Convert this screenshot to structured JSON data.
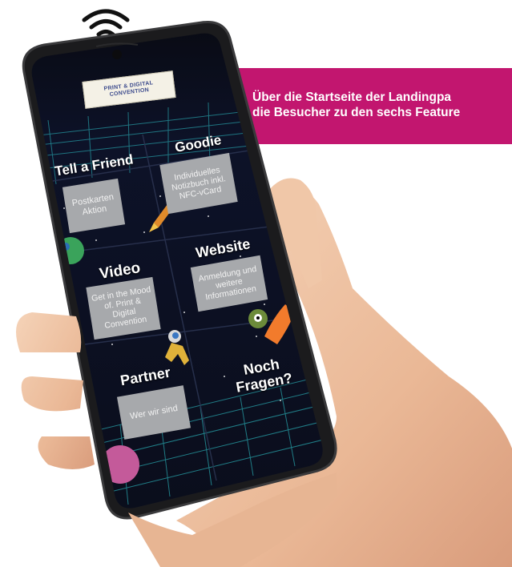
{
  "banner": {
    "line1": "Über die Startseite der Landingpa",
    "line2": "die Besucher zu den sechs Feature"
  },
  "app": {
    "logo_text": "PRINT & DIGITAL CONVENTION",
    "tiles": [
      {
        "title": "Tell a Friend",
        "body": "Postkarten Aktion"
      },
      {
        "title": "Goodie",
        "body": "Individuelles Notizbuch inkl. NFC-vCard"
      },
      {
        "title": "Video",
        "body": "Get in the Mood of. Print & Digital Convention"
      },
      {
        "title": "Website",
        "body": "Anmeldung und weitere Informationen"
      },
      {
        "title": "Partner",
        "body": "Wer wir sind"
      },
      {
        "title": "Noch Fragen?",
        "body": ""
      }
    ]
  },
  "colors": {
    "banner": "#c2166f",
    "phone_body": "#1a1a1a",
    "screen_bg": "#0c0f1c",
    "grid": "#2ec4c8",
    "tile_box": "#a7a9ac",
    "skin": "#efc4a4"
  },
  "icons": [
    "wifi-icon",
    "phone",
    "hand"
  ]
}
